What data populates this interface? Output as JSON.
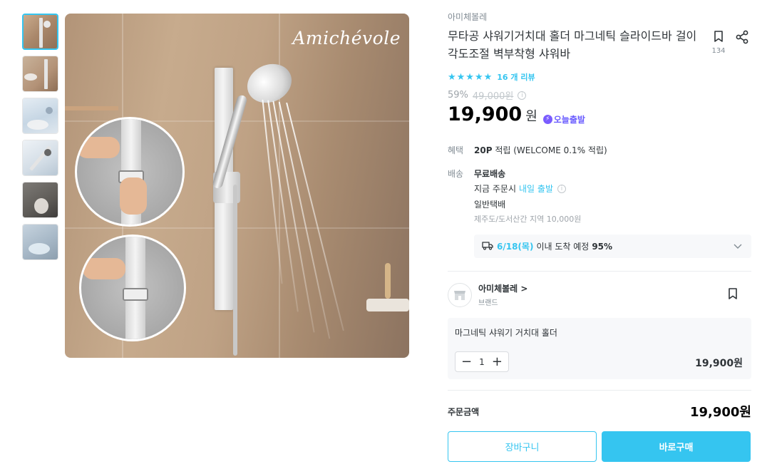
{
  "gallery": {
    "thumbnails": [
      {
        "label": "shower rail in bathroom"
      },
      {
        "label": "wall with towels"
      },
      {
        "label": "magnetic holder closeup"
      },
      {
        "label": "rail angle view"
      },
      {
        "label": "pet bath usage"
      },
      {
        "label": "washing usage"
      }
    ],
    "watermark": "Amichévole"
  },
  "product": {
    "brand": "아미체볼레",
    "title": "무타공 샤워기거치대 홀더 마그네틱 슬라이드바 걸이 각도조절 벽부착형 샤워바",
    "scrap_count": "134",
    "stars": "★★★★★",
    "review_text": "16 개 리뷰",
    "discount_rate": "59%",
    "original_price": "49,000원",
    "price": "19,900",
    "price_unit": "원",
    "today_badge": "오늘출발"
  },
  "benefit": {
    "label": "혜택",
    "points": "20P",
    "text": "적립 (WELCOME 0.1% 적립)"
  },
  "delivery": {
    "label": "배송",
    "type": "무료배송",
    "order_prefix": "지금 주문시",
    "order_highlight": "내일 출발",
    "method": "일반택배",
    "note": "제주도/도서산간 지역 10,000원",
    "arrival_date": "6/18(목)",
    "arrival_text": "이내 도착 예정",
    "arrival_pct": "95%"
  },
  "seller": {
    "name": "아미체볼레",
    "sub": "브랜드",
    "arrow": ">"
  },
  "option": {
    "name": "마그네틱 샤워기 거치대 홀더",
    "minus": "−",
    "qty": "1",
    "plus": "+",
    "price": "19,900원"
  },
  "order": {
    "total_label": "주문금액",
    "total_value": "19,900원",
    "cart_label": "장바구니",
    "buy_label": "바로구매"
  },
  "colors": {
    "accent": "#35c5f0",
    "today_badge": "#6a5cff"
  }
}
